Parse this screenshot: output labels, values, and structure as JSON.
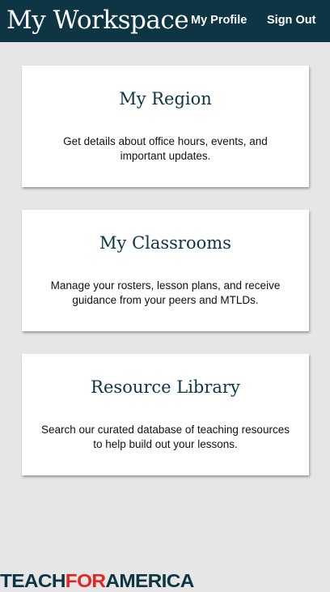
{
  "header": {
    "title": "My Workspace",
    "nav": {
      "profile_label": "My Profile",
      "signout_label": "Sign Out"
    }
  },
  "cards": [
    {
      "title": "My Region",
      "description": "Get details about office hours, events, and important updates."
    },
    {
      "title": "My Classrooms",
      "description": "Manage your rosters, lesson plans, and receive guidance from your peers and MTLDs."
    },
    {
      "title": "Resource Library",
      "description": "Search our curated database of teaching resources to help build out your lessons."
    }
  ],
  "footer": {
    "logo": {
      "part1": "TEACH",
      "part2": "FOR",
      "part3": "AMERICA"
    }
  },
  "colors": {
    "header_bg": "#0e3543",
    "page_bg": "#e6e6e6",
    "card_title": "#0e3543",
    "logo_red": "#e32526"
  }
}
